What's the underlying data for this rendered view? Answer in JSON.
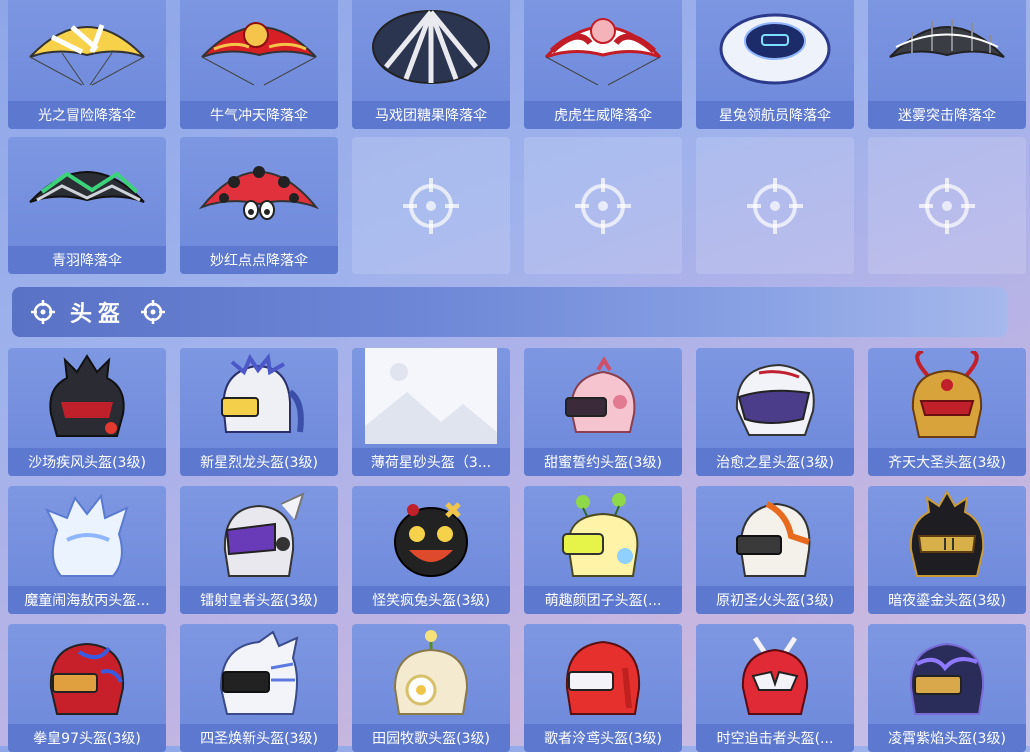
{
  "parachutes": [
    {
      "label": "光之冒险降落伞",
      "icon": "parachute-yellow-icon"
    },
    {
      "label": "牛气冲天降落伞",
      "icon": "parachute-red-gold-icon"
    },
    {
      "label": "马戏团糖果降落伞",
      "icon": "parachute-striped-icon"
    },
    {
      "label": "虎虎生威降落伞",
      "icon": "parachute-tiger-icon"
    },
    {
      "label": "星兔领航员降落伞",
      "icon": "parachute-rabbit-icon"
    },
    {
      "label": "迷雾突击降落伞",
      "icon": "parachute-grey-icon"
    },
    {
      "label": "青羽降落伞",
      "icon": "parachute-green-feather-icon"
    },
    {
      "label": "妙红点点降落伞",
      "icon": "parachute-ladybug-icon"
    }
  ],
  "section": {
    "title": "头盔"
  },
  "helmets": [
    {
      "label": "沙场疾风头盔(3级)",
      "icon": "helmet-red-black-icon"
    },
    {
      "label": "新星烈龙头盔(3级)",
      "icon": "helmet-dragon-icon"
    },
    {
      "label": "薄荷星砂头盔（3...",
      "icon": "image-placeholder-icon"
    },
    {
      "label": "甜蜜誓约头盔(3级)",
      "icon": "helmet-pink-icon"
    },
    {
      "label": "治愈之星头盔(3级)",
      "icon": "helmet-white-purple-icon"
    },
    {
      "label": "齐天大圣头盔(3级)",
      "icon": "helmet-monkey-king-icon"
    },
    {
      "label": "魔童闹海敖丙头盔...",
      "icon": "helmet-ice-icon"
    },
    {
      "label": "镭射皇者头盔(3级)",
      "icon": "helmet-laser-icon"
    },
    {
      "label": "怪笑疯兔头盔(3级)",
      "icon": "helmet-crazy-rabbit-icon"
    },
    {
      "label": "萌趣颜团子头盔(...",
      "icon": "helmet-dango-icon"
    },
    {
      "label": "原初圣火头盔(3级)",
      "icon": "helmet-flame-icon"
    },
    {
      "label": "暗夜鎏金头盔(3级)",
      "icon": "helmet-black-gold-icon"
    },
    {
      "label": "拳皇97头盔(3级)",
      "icon": "helmet-kof-icon"
    },
    {
      "label": "四圣焕新头盔(3级)",
      "icon": "helmet-white-tiger-icon"
    },
    {
      "label": "田园牧歌头盔(3级)",
      "icon": "helmet-flower-icon"
    },
    {
      "label": "歌者泠鸢头盔(3级)",
      "icon": "helmet-singer-icon"
    },
    {
      "label": "时空追击者头盔(...",
      "icon": "helmet-mecha-icon"
    },
    {
      "label": "凌霄紫焰头盔(3级)",
      "icon": "helmet-purple-flame-icon"
    }
  ]
}
